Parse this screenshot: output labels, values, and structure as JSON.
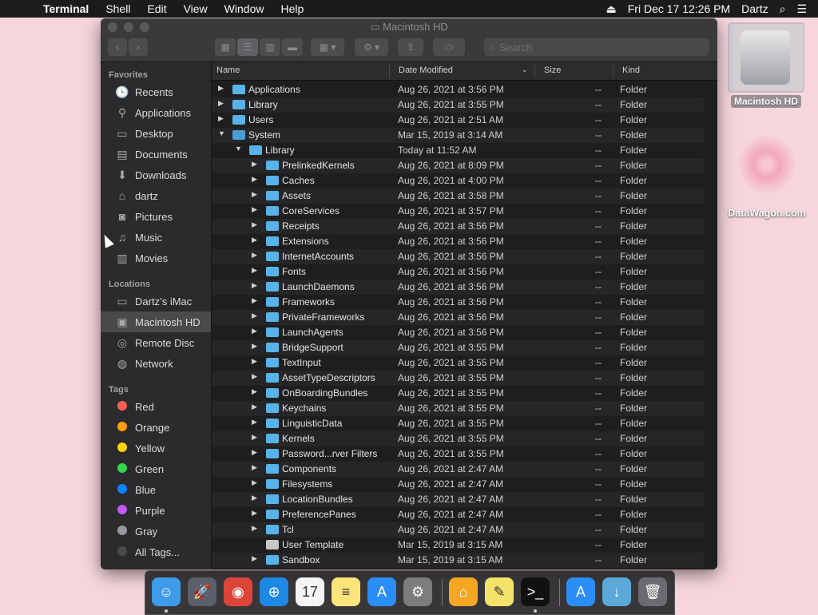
{
  "menubar": {
    "app": "Terminal",
    "items": [
      "Shell",
      "Edit",
      "View",
      "Window",
      "Help"
    ],
    "clock": "Fri Dec 17  12:26 PM",
    "user": "Dartz"
  },
  "desktop": {
    "hd_label": "Macintosh HD",
    "dw_label": "DataWagon.com"
  },
  "window": {
    "title": "Macintosh HD",
    "search_placeholder": "Search"
  },
  "sidebar": {
    "favorites_title": "Favorites",
    "favorites": [
      {
        "label": "Recents",
        "icon": "clock-icon"
      },
      {
        "label": "Applications",
        "icon": "applications-icon"
      },
      {
        "label": "Desktop",
        "icon": "desktop-icon"
      },
      {
        "label": "Documents",
        "icon": "document-icon"
      },
      {
        "label": "Downloads",
        "icon": "download-icon"
      },
      {
        "label": "dartz",
        "icon": "home-icon"
      },
      {
        "label": "Pictures",
        "icon": "camera-icon"
      },
      {
        "label": "Music",
        "icon": "music-icon"
      },
      {
        "label": "Movies",
        "icon": "film-icon"
      }
    ],
    "locations_title": "Locations",
    "locations": [
      {
        "label": "Dartz’s iMac",
        "icon": "imac-icon"
      },
      {
        "label": "Macintosh HD",
        "icon": "harddisk-icon",
        "selected": true
      },
      {
        "label": "Remote Disc",
        "icon": "disc-icon"
      },
      {
        "label": "Network",
        "icon": "globe-icon"
      }
    ],
    "tags_title": "Tags",
    "tags": [
      {
        "label": "Red",
        "color": "#ff5f57"
      },
      {
        "label": "Orange",
        "color": "#ff9f0a"
      },
      {
        "label": "Yellow",
        "color": "#ffd60a"
      },
      {
        "label": "Green",
        "color": "#32d74b"
      },
      {
        "label": "Blue",
        "color": "#0a84ff"
      },
      {
        "label": "Purple",
        "color": "#bf5af2"
      },
      {
        "label": "Gray",
        "color": "#98989d"
      },
      {
        "label": "All Tags...",
        "color": "#4a4a4c"
      }
    ]
  },
  "columns": {
    "name": "Name",
    "date": "Date Modified",
    "size": "Size",
    "kind": "Kind"
  },
  "rows": [
    {
      "name": "Applications",
      "date": "Aug 26, 2021 at 3:56 PM",
      "size": "--",
      "kind": "Folder",
      "level": 0,
      "open": false,
      "icon": "applications-folder-icon"
    },
    {
      "name": "Library",
      "date": "Aug 26, 2021 at 3:55 PM",
      "size": "--",
      "kind": "Folder",
      "level": 0,
      "open": false,
      "icon": "library-folder-icon"
    },
    {
      "name": "Users",
      "date": "Aug 26, 2021 at 2:51 AM",
      "size": "--",
      "kind": "Folder",
      "level": 0,
      "open": false,
      "icon": "users-folder-icon"
    },
    {
      "name": "System",
      "date": "Mar 15, 2019 at 3:14 AM",
      "size": "--",
      "kind": "Folder",
      "level": 0,
      "open": true,
      "icon": "system-folder-icon"
    },
    {
      "name": "Library",
      "date": "Today at 11:52 AM",
      "size": "--",
      "kind": "Folder",
      "level": 1,
      "open": true,
      "icon": "library-folder-icon"
    },
    {
      "name": "PrelinkedKernels",
      "date": "Aug 26, 2021 at 8:09 PM",
      "size": "--",
      "kind": "Folder",
      "level": 2,
      "open": false,
      "icon": "folder-icon"
    },
    {
      "name": "Caches",
      "date": "Aug 26, 2021 at 4:00 PM",
      "size": "--",
      "kind": "Folder",
      "level": 2,
      "open": false,
      "icon": "folder-icon"
    },
    {
      "name": "Assets",
      "date": "Aug 26, 2021 at 3:58 PM",
      "size": "--",
      "kind": "Folder",
      "level": 2,
      "open": false,
      "icon": "folder-icon"
    },
    {
      "name": "CoreServices",
      "date": "Aug 26, 2021 at 3:57 PM",
      "size": "--",
      "kind": "Folder",
      "level": 2,
      "open": false,
      "icon": "folder-icon"
    },
    {
      "name": "Receipts",
      "date": "Aug 26, 2021 at 3:56 PM",
      "size": "--",
      "kind": "Folder",
      "level": 2,
      "open": false,
      "icon": "folder-icon"
    },
    {
      "name": "Extensions",
      "date": "Aug 26, 2021 at 3:56 PM",
      "size": "--",
      "kind": "Folder",
      "level": 2,
      "open": false,
      "icon": "folder-icon"
    },
    {
      "name": "InternetAccounts",
      "date": "Aug 26, 2021 at 3:56 PM",
      "size": "--",
      "kind": "Folder",
      "level": 2,
      "open": false,
      "icon": "folder-icon"
    },
    {
      "name": "Fonts",
      "date": "Aug 26, 2021 at 3:56 PM",
      "size": "--",
      "kind": "Folder",
      "level": 2,
      "open": false,
      "icon": "folder-icon"
    },
    {
      "name": "LaunchDaemons",
      "date": "Aug 26, 2021 at 3:56 PM",
      "size": "--",
      "kind": "Folder",
      "level": 2,
      "open": false,
      "icon": "folder-icon"
    },
    {
      "name": "Frameworks",
      "date": "Aug 26, 2021 at 3:56 PM",
      "size": "--",
      "kind": "Folder",
      "level": 2,
      "open": false,
      "icon": "folder-icon"
    },
    {
      "name": "PrivateFrameworks",
      "date": "Aug 26, 2021 at 3:56 PM",
      "size": "--",
      "kind": "Folder",
      "level": 2,
      "open": false,
      "icon": "folder-icon"
    },
    {
      "name": "LaunchAgents",
      "date": "Aug 26, 2021 at 3:56 PM",
      "size": "--",
      "kind": "Folder",
      "level": 2,
      "open": false,
      "icon": "folder-icon"
    },
    {
      "name": "BridgeSupport",
      "date": "Aug 26, 2021 at 3:55 PM",
      "size": "--",
      "kind": "Folder",
      "level": 2,
      "open": false,
      "icon": "folder-icon"
    },
    {
      "name": "TextInput",
      "date": "Aug 26, 2021 at 3:55 PM",
      "size": "--",
      "kind": "Folder",
      "level": 2,
      "open": false,
      "icon": "folder-icon"
    },
    {
      "name": "AssetTypeDescriptors",
      "date": "Aug 26, 2021 at 3:55 PM",
      "size": "--",
      "kind": "Folder",
      "level": 2,
      "open": false,
      "icon": "folder-icon"
    },
    {
      "name": "OnBoardingBundles",
      "date": "Aug 26, 2021 at 3:55 PM",
      "size": "--",
      "kind": "Folder",
      "level": 2,
      "open": false,
      "icon": "folder-icon"
    },
    {
      "name": "Keychains",
      "date": "Aug 26, 2021 at 3:55 PM",
      "size": "--",
      "kind": "Folder",
      "level": 2,
      "open": false,
      "icon": "folder-icon"
    },
    {
      "name": "LinguisticData",
      "date": "Aug 26, 2021 at 3:55 PM",
      "size": "--",
      "kind": "Folder",
      "level": 2,
      "open": false,
      "icon": "folder-icon"
    },
    {
      "name": "Kernels",
      "date": "Aug 26, 2021 at 3:55 PM",
      "size": "--",
      "kind": "Folder",
      "level": 2,
      "open": false,
      "icon": "folder-icon"
    },
    {
      "name": "Password...rver Filters",
      "date": "Aug 26, 2021 at 3:55 PM",
      "size": "--",
      "kind": "Folder",
      "level": 2,
      "open": false,
      "icon": "folder-icon"
    },
    {
      "name": "Components",
      "date": "Aug 26, 2021 at 2:47 AM",
      "size": "--",
      "kind": "Folder",
      "level": 2,
      "open": false,
      "icon": "folder-icon"
    },
    {
      "name": "Filesystems",
      "date": "Aug 26, 2021 at 2:47 AM",
      "size": "--",
      "kind": "Folder",
      "level": 2,
      "open": false,
      "icon": "folder-icon"
    },
    {
      "name": "LocationBundles",
      "date": "Aug 26, 2021 at 2:47 AM",
      "size": "--",
      "kind": "Folder",
      "level": 2,
      "open": false,
      "icon": "folder-icon"
    },
    {
      "name": "PreferencePanes",
      "date": "Aug 26, 2021 at 2:47 AM",
      "size": "--",
      "kind": "Folder",
      "level": 2,
      "open": false,
      "icon": "folder-icon"
    },
    {
      "name": "Tcl",
      "date": "Aug 26, 2021 at 2:47 AM",
      "size": "--",
      "kind": "Folder",
      "level": 2,
      "open": false,
      "icon": "folder-icon"
    },
    {
      "name": "User Template",
      "date": "Mar 15, 2019 at 3:15 AM",
      "size": "--",
      "kind": "Folder",
      "level": 2,
      "open": null,
      "icon": "restricted-folder-icon"
    },
    {
      "name": "Sandbox",
      "date": "Mar 15, 2019 at 3:15 AM",
      "size": "--",
      "kind": "Folder",
      "level": 2,
      "open": false,
      "icon": "folder-icon"
    }
  ],
  "dock": [
    {
      "name": "finder-icon",
      "color": "#3d9be9",
      "glyph": "☺",
      "running": true
    },
    {
      "name": "launchpad-icon",
      "color": "#5b5f6b",
      "glyph": "🚀",
      "running": false
    },
    {
      "name": "chrome-icon",
      "color": "#db4437",
      "glyph": "◉",
      "running": false
    },
    {
      "name": "safari-icon",
      "color": "#1e88e5",
      "glyph": "⊕",
      "running": false
    },
    {
      "name": "calendar-icon",
      "color": "#f4f4f4",
      "glyph": "17",
      "running": false
    },
    {
      "name": "notes-icon",
      "color": "#fbe57b",
      "glyph": "≡",
      "running": false
    },
    {
      "name": "appstore-icon",
      "color": "#2b8ef6",
      "glyph": "A",
      "running": false
    },
    {
      "name": "system-preferences-icon",
      "color": "#7d7d80",
      "glyph": "⚙",
      "running": false
    },
    {
      "name": "home-app-icon",
      "color": "#f5a623",
      "glyph": "⌂",
      "running": false
    },
    {
      "name": "stickies-icon",
      "color": "#f4e36a",
      "glyph": "✎",
      "running": false
    },
    {
      "name": "terminal-icon",
      "color": "#111111",
      "glyph": ">_",
      "running": true
    },
    {
      "name": "appstore-downloads-icon",
      "color": "#2b8ef6",
      "glyph": "A",
      "running": false
    },
    {
      "name": "downloads-folder-icon",
      "color": "#5aa9d8",
      "glyph": "↓",
      "running": false
    },
    {
      "name": "trash-icon",
      "color": "#6c6c70",
      "glyph": "🗑",
      "running": false
    }
  ]
}
